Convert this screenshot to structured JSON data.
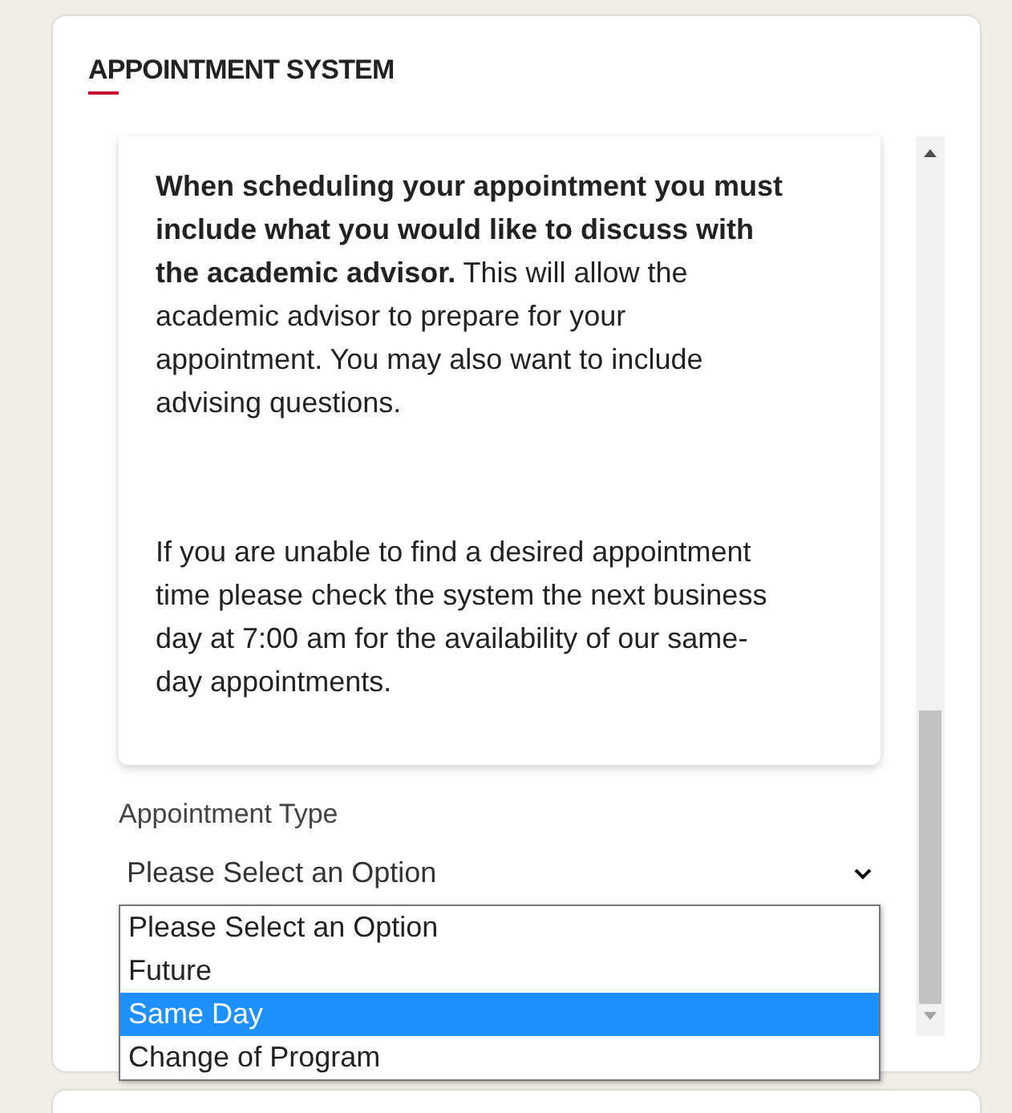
{
  "panel": {
    "title": "APPOINTMENT SYSTEM"
  },
  "info_card": {
    "paragraphs": [
      "**When scheduling your appointment you must include what you would like to discuss with the academic advisor.** This will allow the academic advisor to prepare for your appointment. You may also want to include advising questions.",
      "If you are unable to find a desired appointment time please check the system the next business day at 7:00 am for the availability of our same-day appointments."
    ]
  },
  "appointment_type": {
    "label": "Appointment Type",
    "value": "Please Select an Option",
    "expanded": true,
    "options": [
      {
        "label": "Please Select an Option",
        "highlighted": false
      },
      {
        "label": "Future",
        "highlighted": false
      },
      {
        "label": "Same Day",
        "highlighted": true
      },
      {
        "label": "Change of Program",
        "highlighted": false
      }
    ]
  }
}
